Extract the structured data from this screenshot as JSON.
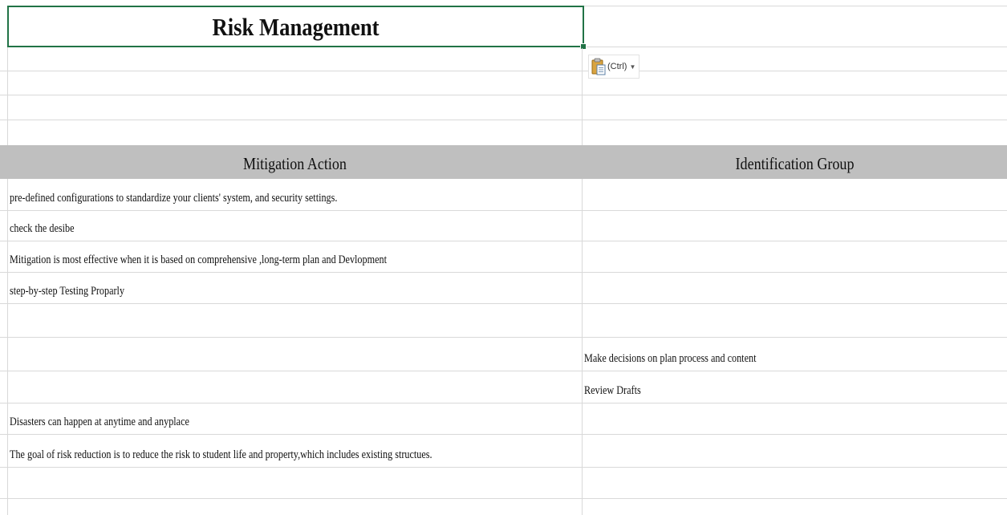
{
  "sheet": {
    "title": "Risk Management",
    "paste_options": {
      "label": "(Ctrl)",
      "icon": "clipboard-paste-icon",
      "dropdown_icon": "triangle-down-icon"
    },
    "headers": {
      "col_a": "Mitigation Action",
      "col_b": "Identification Group"
    },
    "rows": [
      {
        "a": "pre-defined configurations to standardize your clients' system, and security settings.",
        "b": ""
      },
      {
        "a": "check the desibe",
        "b": ""
      },
      {
        "a": "Mitigation  is most effective when it is based on comprehensive ,long-term plan and Devlopment",
        "b": ""
      },
      {
        "a": "step-by-step Testing Proparly",
        "b": ""
      },
      {
        "a": "",
        "b": ""
      },
      {
        "a": "",
        "b": "Make decisions on plan process and content"
      },
      {
        "a": "",
        "b": "Review Drafts"
      },
      {
        "a": "Disasters can happen at anytime and anyplace",
        "b": ""
      },
      {
        "a": "The goal of risk reduction is to reduce the risk to student life and property,which includes existing structues.",
        "b": ""
      },
      {
        "a": "",
        "b": ""
      },
      {
        "a": "",
        "b": ""
      }
    ],
    "colors": {
      "header_fill": "#bfbfbf",
      "selection_border": "#217346",
      "gridline": "#d9d9d9"
    }
  }
}
